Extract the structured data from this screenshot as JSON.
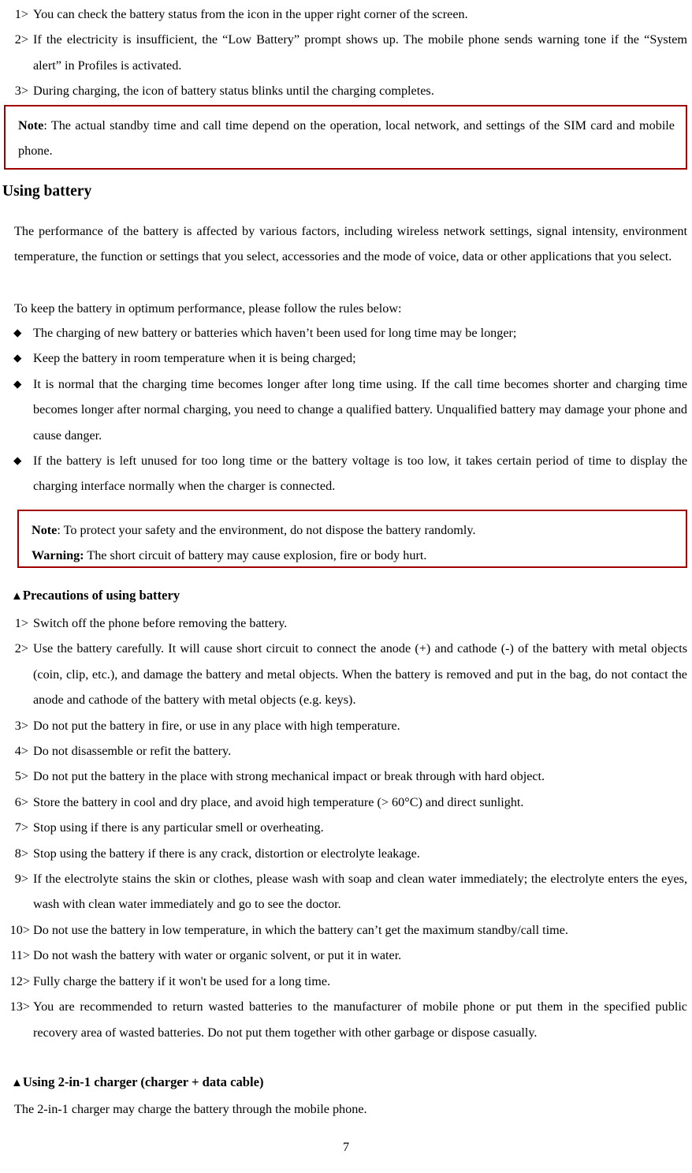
{
  "document": {
    "page_number": "7"
  },
  "intro_list": [
    {
      "marker": "1>",
      "text": "You can check the battery status from the icon in the upper right corner of the screen."
    },
    {
      "marker": "2>",
      "text": "If the electricity is insufficient, the “Low Battery” prompt shows up. The mobile phone sends warning tone if the “System alert” in Profiles is activated."
    },
    {
      "marker": "3>",
      "text": "During charging, the icon of battery status blinks until the charging completes."
    }
  ],
  "note_box_1": {
    "lead": "Note",
    "text": ": The actual standby time and call time depend on the operation, local network, and settings of the SIM card and mobile phone.",
    "border_color": "#A00000"
  },
  "heading_using_battery": "Using battery",
  "battery_paragraph": "The performance of the battery is affected by various factors, including wireless network settings, signal intensity, environment temperature, the function or settings that you select, accessories and the mode of voice, data or other applications that you select.",
  "rules_intro": "To keep the battery in optimum performance, please follow the rules below:",
  "rules_list": [
    {
      "bullet": "diamond-bullet",
      "glyph": "◆",
      "text": "The charging of new battery or batteries which haven’t been used for long time may be longer;"
    },
    {
      "bullet": "diamond-bullet",
      "glyph": "◆",
      "text": "Keep the battery in room temperature when it is being charged;"
    },
    {
      "bullet": "diamond-bullet",
      "glyph": "◆",
      "text": "It is normal that the charging time becomes longer after long time using. If the call time becomes shorter and charging time becomes longer after normal charging, you need to change a qualified battery. Unqualified battery may damage your phone and cause danger."
    },
    {
      "bullet": "diamond-bullet",
      "glyph": "◆",
      "text": "If the battery is left unused for too long time or the battery voltage is too low, it takes certain period of time to display the charging interface normally when the charger is connected."
    }
  ],
  "note_box_2": {
    "note_lead": "Note",
    "note_text": ": To protect your safety and the environment, do not dispose the battery randomly.",
    "warning_lead": "Warning:",
    "warning_text": " The short circuit of battery may cause explosion, fire or body hurt.",
    "border_color": "#A00000"
  },
  "heading_precautions": {
    "glyph": "▲",
    "label": "Precautions of using battery"
  },
  "precautions_list": [
    {
      "marker": "1>",
      "text": "Switch off the phone before removing the battery."
    },
    {
      "marker": "2>",
      "text": "Use the battery carefully. It will cause short circuit to connect the anode (+) and cathode (-) of the battery with metal objects (coin, clip, etc.), and damage the battery and metal objects. When the battery is removed and put in the bag, do not contact the anode and cathode of the battery with metal objects (e.g. keys)."
    },
    {
      "marker": "3>",
      "text": "Do not put the battery in fire, or use in any place with high temperature."
    },
    {
      "marker": "4>",
      "text": "Do not disassemble or refit the battery."
    },
    {
      "marker": "5>",
      "text": "Do not put the battery in the place with strong mechanical impact or break through with hard object."
    },
    {
      "marker": "6>",
      "text": "Store the battery in cool and dry place, and avoid high temperature (> 60°C) and direct sunlight."
    },
    {
      "marker": "7>",
      "text": "Stop using if there is any particular smell or overheating."
    },
    {
      "marker": "8>",
      "text": "Stop using the battery if there is any crack, distortion or electrolyte leakage."
    },
    {
      "marker": "9>",
      "text": "If the electrolyte stains the skin or clothes, please wash with soap and clean water immediately; the electrolyte enters the eyes, wash with clean water immediately and go to see the doctor."
    },
    {
      "marker": "10>",
      "text": "Do not use the battery in low temperature, in which the battery can’t get the maximum standby/call time."
    },
    {
      "marker": "11>",
      "text": "Do not wash the battery with water or organic solvent, or put it in water."
    },
    {
      "marker": "12>",
      "text": "Fully charge the battery if it won't be used for a long time."
    },
    {
      "marker": "13>",
      "text": "You are recommended to return wasted batteries to the manufacturer of mobile phone or put them in the specified public recovery area of wasted batteries. Do not put them together with other garbage or dispose casually."
    }
  ],
  "heading_charger": {
    "glyph": "▲",
    "label": "Using 2-in-1 charger (charger + data cable)"
  },
  "charger_paragraph": "The 2-in-1 charger may charge the battery through the mobile phone."
}
